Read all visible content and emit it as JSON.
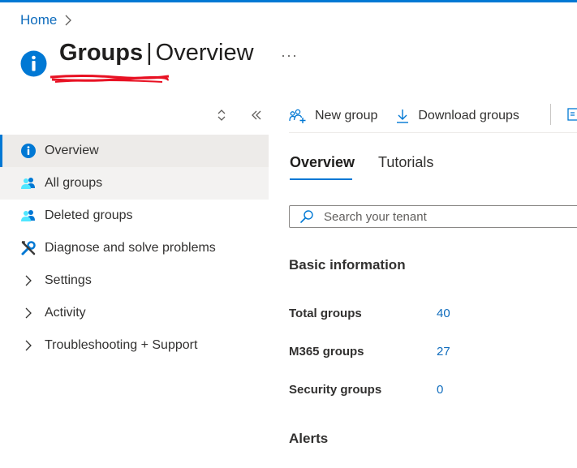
{
  "breadcrumb": {
    "home": "Home"
  },
  "header": {
    "title": "Groups",
    "separator": "|",
    "subtitle": "Overview",
    "more": "···"
  },
  "sidebar": {
    "items": [
      {
        "label": "Overview",
        "icon": "info-icon"
      },
      {
        "label": "All groups",
        "icon": "groups-icon"
      },
      {
        "label": "Deleted groups",
        "icon": "groups-icon"
      },
      {
        "label": "Diagnose and solve problems",
        "icon": "wrench-icon"
      },
      {
        "label": "Settings",
        "icon": "chevron-right-icon"
      },
      {
        "label": "Activity",
        "icon": "chevron-right-icon"
      },
      {
        "label": "Troubleshooting + Support",
        "icon": "chevron-right-icon"
      }
    ]
  },
  "toolbar": {
    "new_group": "New group",
    "download_groups": "Download groups"
  },
  "tabs": [
    {
      "label": "Overview"
    },
    {
      "label": "Tutorials"
    }
  ],
  "search": {
    "placeholder": "Search your tenant"
  },
  "basic_info": {
    "title": "Basic information",
    "rows": [
      {
        "label": "Total groups",
        "value": "40"
      },
      {
        "label": "M365 groups",
        "value": "27"
      },
      {
        "label": "Security groups",
        "value": "0"
      }
    ]
  },
  "alerts": {
    "title": "Alerts"
  },
  "colors": {
    "accent": "#0078d4",
    "link": "#0f6cbd",
    "selected_bg": "#edebe9",
    "redaction": "#e81123"
  }
}
